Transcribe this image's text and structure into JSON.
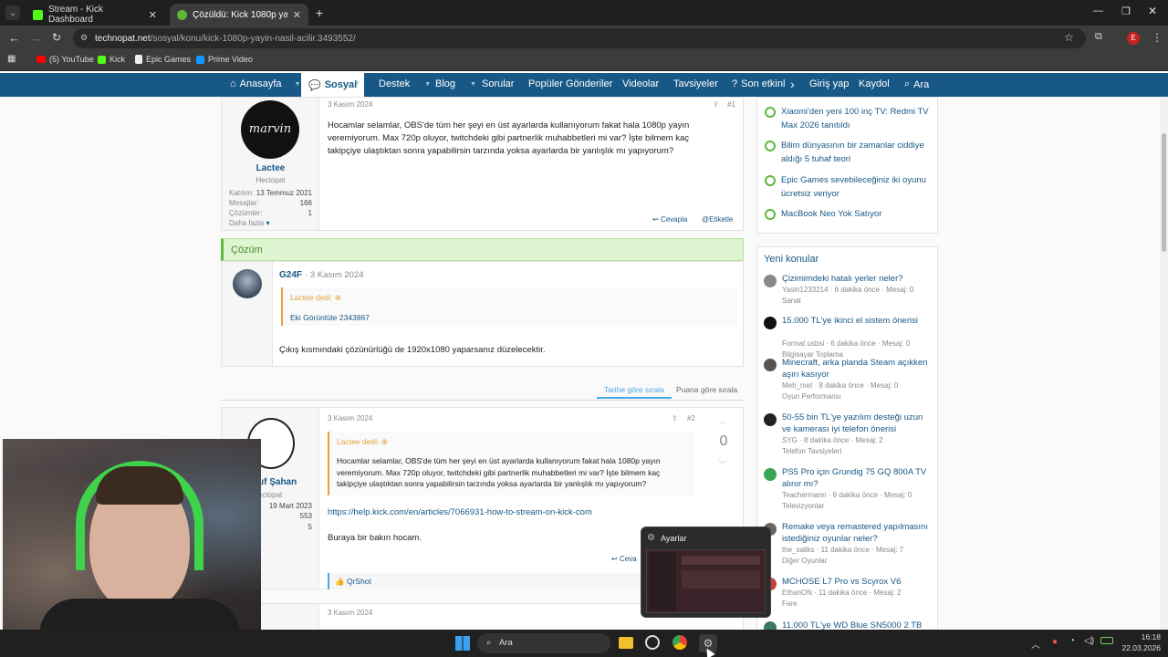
{
  "browser": {
    "tabs": [
      {
        "title": "Stream - Kick Dashboard",
        "active": false
      },
      {
        "title": "Çözüldü: Kick 1080p yayın nasıl",
        "active": true
      }
    ],
    "url_host": "technopat.net",
    "url_path": "/sosyal/konu/kick-1080p-yayin-nasil-acilir.3493552/",
    "profile_initial": "E",
    "bookmarks": [
      "(5) YouTube",
      "Kick",
      "Epic Games",
      "Prime Video"
    ]
  },
  "site_nav": {
    "items": [
      "Anasayfa",
      "Sosyal",
      "Destek",
      "Blog",
      "Sorular",
      "Popüler Gönderiler",
      "Videolar",
      "Tavsiyeler",
      "Son etkinl"
    ],
    "login": "Giriş yap",
    "register": "Kaydol",
    "search": "Ara"
  },
  "first_post": {
    "username": "Lactee",
    "role": "Hectopat",
    "stats": [
      {
        "label": "Katılım:",
        "value": "13 Temmuz 2021"
      },
      {
        "label": "Mesajlar:",
        "value": "166"
      },
      {
        "label": "Çözümler:",
        "value": "1"
      }
    ],
    "more": "Daha fazla",
    "date": "3 Kasım 2024",
    "number": "#1",
    "body": "Hocamlar selamlar, OBS'de tüm her şeyi en üst ayarlarda kullanıyorum fakat hala 1080p yayın veremiyorum. Max 720p oluyor, twitchdeki gibi partnerlik muhabbetleri mi var? İşte bilmem kaç takipçiye ulaştıktan sonra yapabilirsin tarzında yoksa ayarlarda bir yanlışlık mı yapıyorum?",
    "reply": "Cevapla",
    "tag": "Etiketle",
    "avatar_text": "marvin"
  },
  "solution": {
    "header": "Çözüm",
    "username": "G24F",
    "date": "3 Kasım 2024",
    "quote_author": "Lactee dedi:",
    "quote_text": "Eki Görüntüle 2343867",
    "body": "Çıkış kısmındaki çözünürlüğü de 1920x1080 yaparsanız düzelecektir."
  },
  "sort": {
    "by_date": "Tarihe göre sırala",
    "by_score": "Puana göre sırala"
  },
  "second_post": {
    "username": "uf Şahan",
    "role": "ectopat",
    "stats": [
      "19 Mart 2023",
      "553",
      "5"
    ],
    "date": "3 Kasım 2024",
    "number": "#2",
    "score": "0",
    "quote_author": "Lactee dedi:",
    "quote_text": "Hocamlar selamlar, OBS'de tüm her şeyi en üst ayarlarda kullanıyorum fakat hala 1080p yayın veremiyorum. Max 720p oluyor, twitchdeki gibi partnerlik muhabbetleri mi var? İşte bilmem kaç takipçiye ulaştıktan sonra yapabilirsin tarzında yoksa ayarlarda bir yanlışlık mı yapıyorum?",
    "link": "https://help.kick.com/en/articles/7066931-how-to-stream-on-kick-com",
    "body": "Buraya bir bakın hocam.",
    "reaction": "QrShot",
    "reply": "Ceva"
  },
  "third_post": {
    "date": "3 Kasım 2024"
  },
  "sidebar_top": {
    "items": [
      "Xiaomi'den yeni 100 inç TV: Redmi TV Max 2026 tanıtıldı",
      "Bilim dünyasının bir zamanlar ciddiye aldığı 5 tuhaf teori",
      "Epic Games sevebileceğiniz iki oyunu ücretsiz veriyor",
      "MacBook Neo Yok Satıyor"
    ]
  },
  "new_topics": {
    "title": "Yeni konular",
    "items": [
      {
        "title": "Çizimimdeki hatalı yerler neler?",
        "meta": "Yasin1233214 · 6 dakika önce · Mesaj: 0",
        "forum": "Sanat",
        "color": "#888888"
      },
      {
        "title": "15.000 TL'ye ikinci el sistem önerisi",
        "meta": "Format usbsi · 6 dakika önce · Mesaj: 0",
        "forum": "Bilgisayar Toplama",
        "color": "#111111"
      },
      {
        "title": "Minecraft, arka planda Steam açıkken aşırı kasıyor",
        "meta": "Meh_met · 8 dakika önce · Mesaj: 0",
        "forum": "Oyun Performansı",
        "color": "#555555"
      },
      {
        "title": "50-55 bin TL'ye yazılım desteği uzun ve kamerası iyi telefon önerisi",
        "meta": "SYG · 8 dakika önce · Mesaj: 2",
        "forum": "Telefon Tavsiyeleri",
        "color": "#222222"
      },
      {
        "title": "PS5 Pro için Grundig 75 GQ 800A TV alınır mı?",
        "meta": "Teachermann · 9 dakika önce · Mesaj: 0",
        "forum": "Televizyonlar",
        "color": "#3aa356"
      },
      {
        "title": "Remake veya remastered yapılmasını istediğiniz oyunlar neler?",
        "meta": "the_saliks · 11 dakika önce · Mesaj: 7",
        "forum": "Diğer Oyunlar",
        "color": "#666666"
      },
      {
        "title": "MCHOSE L7 Pro vs Scyrox V6",
        "meta": "EthanON · 11 dakika önce · Mesaj: 2",
        "forum": "Fare",
        "color": "#c04040"
      },
      {
        "title": "11.000 TL'ye WD Blue SN5000 2 TB",
        "meta": "",
        "forum": "",
        "color": "#3a7a60"
      }
    ]
  },
  "popup": {
    "title": "Ayarlar"
  },
  "taskbar": {
    "search": "Ara",
    "time": "16:18",
    "date": "22.03.2026"
  }
}
